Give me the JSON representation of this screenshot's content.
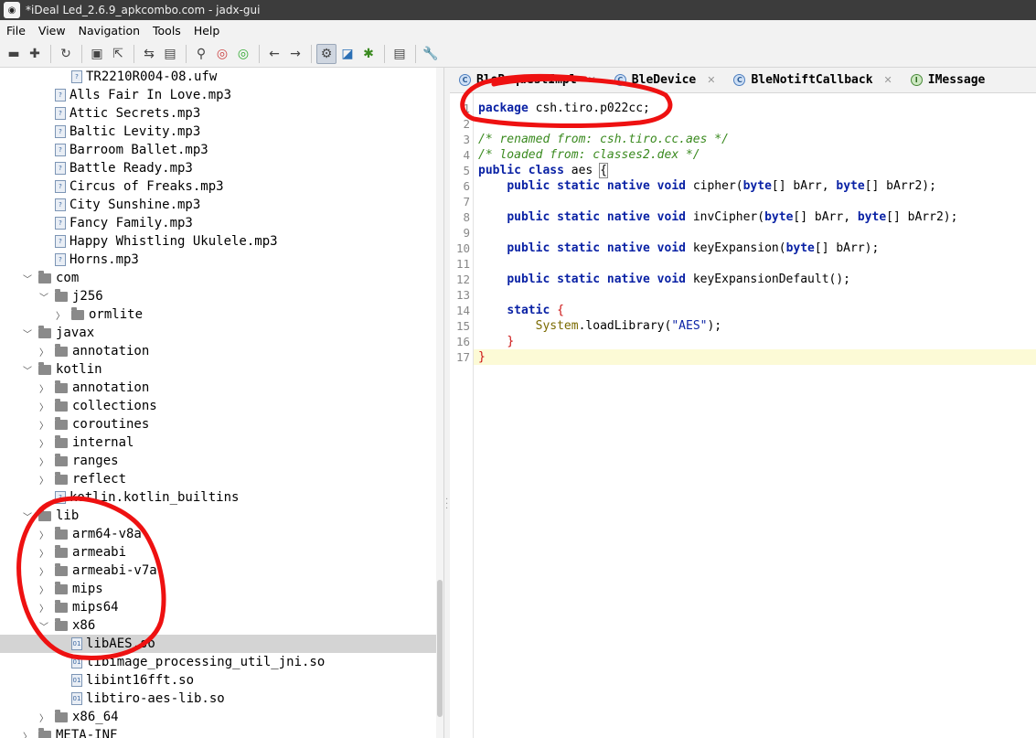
{
  "window": {
    "title": "*iDeal Led_2.6.9_apkcombo.com - jadx-gui",
    "app_icon": "jadx-logo-icon"
  },
  "menu": {
    "items": [
      "File",
      "View",
      "Navigation",
      "Tools",
      "Help"
    ]
  },
  "toolbar": {
    "icons": [
      "open-folder-icon",
      "add-files-icon",
      "refresh-icon",
      "save-icon",
      "export-icon",
      "sync-icon",
      "folder-icon",
      "search-icon",
      "find-class-icon",
      "find-usage-icon",
      "back-icon",
      "forward-icon",
      "deobfuscation-toggle-icon",
      "quark-icon",
      "debug-bug-icon",
      "log-viewer-icon",
      "settings-wrench-icon"
    ]
  },
  "tree": {
    "rows": [
      {
        "label": "TR2210R004-08.ufw",
        "kind": "file"
      },
      {
        "label": "Alls Fair In Love.mp3",
        "kind": "file"
      },
      {
        "label": "Attic Secrets.mp3",
        "kind": "file"
      },
      {
        "label": "Baltic Levity.mp3",
        "kind": "file"
      },
      {
        "label": "Barroom Ballet.mp3",
        "kind": "file"
      },
      {
        "label": "Battle Ready.mp3",
        "kind": "file"
      },
      {
        "label": "Circus of Freaks.mp3",
        "kind": "file"
      },
      {
        "label": "City Sunshine.mp3",
        "kind": "file"
      },
      {
        "label": "Fancy Family.mp3",
        "kind": "file"
      },
      {
        "label": "Happy Whistling Ukulele.mp3",
        "kind": "file"
      },
      {
        "label": "Horns.mp3",
        "kind": "file"
      },
      {
        "label": "com",
        "kind": "folder-open"
      },
      {
        "label": "j256",
        "kind": "folder-open"
      },
      {
        "label": "ormlite",
        "kind": "folder-closed"
      },
      {
        "label": "javax",
        "kind": "folder-open"
      },
      {
        "label": "annotation",
        "kind": "folder-closed"
      },
      {
        "label": "kotlin",
        "kind": "folder-open"
      },
      {
        "label": "annotation",
        "kind": "folder-closed"
      },
      {
        "label": "collections",
        "kind": "folder-closed"
      },
      {
        "label": "coroutines",
        "kind": "folder-closed"
      },
      {
        "label": "internal",
        "kind": "folder-closed"
      },
      {
        "label": "ranges",
        "kind": "folder-closed"
      },
      {
        "label": "reflect",
        "kind": "folder-closed"
      },
      {
        "label": "kotlin.kotlin_builtins",
        "kind": "file"
      },
      {
        "label": "lib",
        "kind": "folder-open"
      },
      {
        "label": "arm64-v8a",
        "kind": "folder-closed"
      },
      {
        "label": "armeabi",
        "kind": "folder-closed"
      },
      {
        "label": "armeabi-v7a",
        "kind": "folder-closed"
      },
      {
        "label": "mips",
        "kind": "folder-closed"
      },
      {
        "label": "mips64",
        "kind": "folder-closed"
      },
      {
        "label": "x86",
        "kind": "folder-open"
      },
      {
        "label": "libAES.so",
        "kind": "so-file",
        "selected": true
      },
      {
        "label": "libimage_processing_util_jni.so",
        "kind": "so-file"
      },
      {
        "label": "libint16fft.so",
        "kind": "so-file"
      },
      {
        "label": "libtiro-aes-lib.so",
        "kind": "so-file"
      },
      {
        "label": "x86_64",
        "kind": "folder-closed"
      },
      {
        "label": "META-INF",
        "kind": "folder-closed"
      }
    ]
  },
  "tabs": [
    {
      "label": "BleRequestImpl",
      "icon": "class-icon"
    },
    {
      "label": "BleDevice",
      "icon": "class-icon"
    },
    {
      "label": "BleNotiftCallback",
      "icon": "class-icon"
    },
    {
      "label": "IMessage",
      "icon": "interface-icon"
    }
  ],
  "code": {
    "line_numbers": [
      "1",
      "2",
      "3",
      "4",
      "5",
      "6",
      "7",
      "8",
      "9",
      "10",
      "11",
      "12",
      "13",
      "14",
      "15",
      "16",
      "17"
    ],
    "package_keyword": "package",
    "package_name": "csh.tiro.p022cc;",
    "comment_renamed": "/* renamed from: csh.tiro.cc.aes */",
    "comment_loaded": "/* loaded from: classes2.dex */",
    "class_keywords": "public class",
    "class_name": "aes",
    "open_brace": "{",
    "close_brace": "}",
    "modifiers": "public static native void",
    "byte_kw": "byte",
    "m1_name": "cipher(",
    "m1_arg1": "[] bArr, ",
    "m1_arg2": "[] bArr2);",
    "m2_name": "invCipher(",
    "m2_arg1": "[] bArr, ",
    "m2_arg2": "[] bArr2);",
    "m3_name": "keyExpansion(",
    "m3_arg": "[] bArr);",
    "m4_sig": "keyExpansionDefault();",
    "static_kw": "static",
    "system_ref": "System",
    "load_call": ".loadLibrary(",
    "library_name": "\"AES\"",
    "load_end": ");"
  },
  "colors": {
    "annotation_red": "#ee1111",
    "keyword_blue": "#0a22a5",
    "comment_green": "#3a8a1f",
    "selection_gray": "#d4d4d4",
    "current_line_yellow": "#fcfad6"
  }
}
